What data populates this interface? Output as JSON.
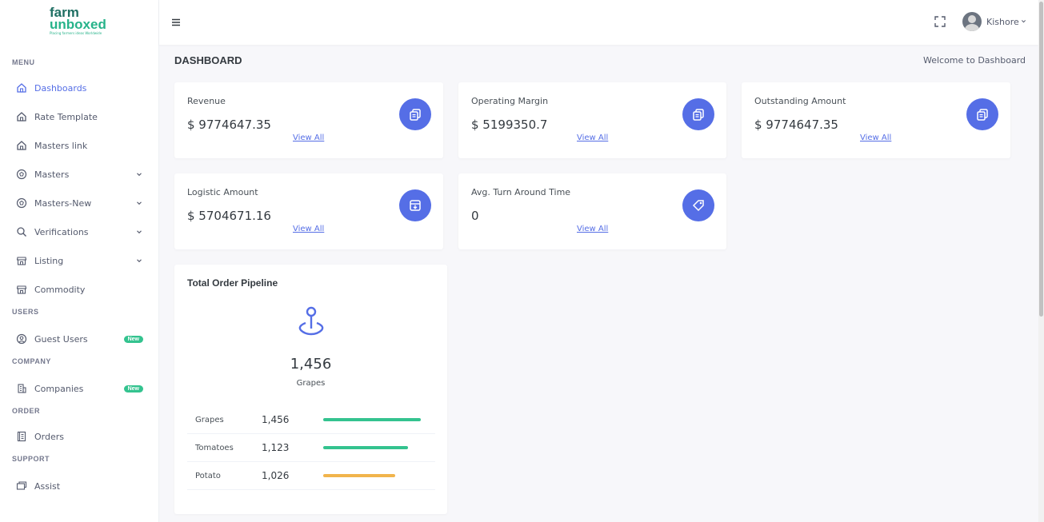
{
  "logo": {
    "line1": "farm",
    "line2": "unboxed",
    "tagline": "Placing farmers ideas Worldwide"
  },
  "sidebar": {
    "sections": {
      "menu": "MENU",
      "users": "USERS",
      "company": "COMPANY",
      "order": "ORDER",
      "support": "SUPPORT"
    },
    "items": {
      "dashboards": "Dashboards",
      "rate_template": "Rate Template",
      "masters_link": "Masters link",
      "masters": "Masters",
      "masters_new": "Masters-New",
      "verifications": "Verifications",
      "listing": "Listing",
      "commodity": "Commodity",
      "guest_users": "Guest Users",
      "companies": "Companies",
      "orders": "Orders",
      "assist": "Assist"
    },
    "badge_new": "New"
  },
  "header": {
    "user_name": "Kishore"
  },
  "page": {
    "title": "DASHBOARD",
    "welcome": "Welcome to Dashboard"
  },
  "stats": [
    {
      "label": "Revenue",
      "value": "$ 9774647.35",
      "link": "View All"
    },
    {
      "label": "Operating Margin",
      "value": "$ 5199350.7",
      "link": "View All"
    },
    {
      "label": "Outstanding Amount",
      "value": "$ 9774647.35",
      "link": "View All"
    },
    {
      "label": "Logistic Amount",
      "value": "$ 5704671.16",
      "link": "View All"
    },
    {
      "label": "Avg. Turn Around Time",
      "value": "0",
      "link": "View All"
    }
  ],
  "pipeline": {
    "title": "Total Order Pipeline",
    "total": "1,456",
    "total_label": "Grapes",
    "rows": [
      {
        "name": "Grapes",
        "value": "1,456",
        "fraction": 0.99,
        "color": "#34c38f"
      },
      {
        "name": "Tomatoes",
        "value": "1,123",
        "fraction": 0.86,
        "color": "#34c38f"
      },
      {
        "name": "Potato",
        "value": "1,026",
        "fraction": 0.73,
        "color": "#f1b44c"
      }
    ]
  },
  "colors": {
    "accent": "#556ee6",
    "success": "#34c38f",
    "warning": "#f1b44c"
  }
}
